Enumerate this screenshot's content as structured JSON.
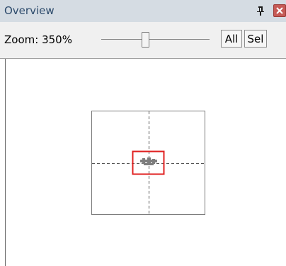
{
  "window": {
    "title": "Overview",
    "pin_icon": "pushpin-icon",
    "close_icon": "close-icon"
  },
  "toolbar": {
    "zoom_label": "Zoom: 350%",
    "zoom_slider_level": 0.4,
    "all_label": "All",
    "sel_label": "Sel"
  },
  "colors": {
    "titlebar_bg": "#d5dce3",
    "title_text": "#2c4a6b",
    "viewport_rect": "#e02020",
    "diagram_border": "#7a7a7a",
    "crosshair": "#555555"
  }
}
